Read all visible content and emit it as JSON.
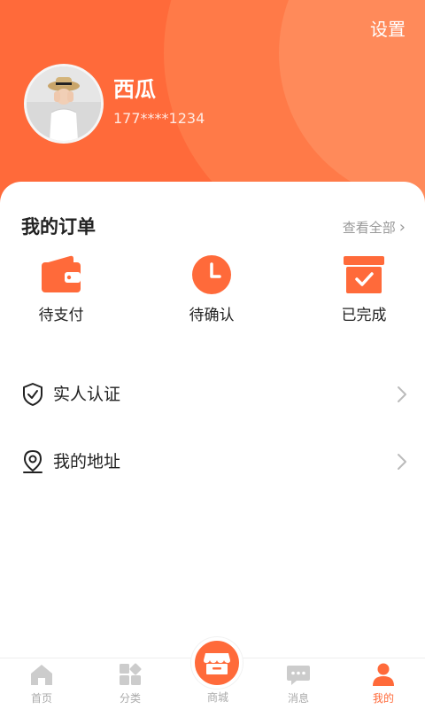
{
  "colors": {
    "accent": "#ff6a3a",
    "text": "#222222",
    "muted": "#999999",
    "tab_inactive": "#aaaaaa"
  },
  "header": {
    "settings_label": "设置",
    "username": "西瓜",
    "phone": "177****1234"
  },
  "orders": {
    "title": "我的订单",
    "view_all_label": "查看全部",
    "items": [
      {
        "label": "待支付",
        "icon": "wallet-icon"
      },
      {
        "label": "待确认",
        "icon": "clock-icon"
      },
      {
        "label": "已完成",
        "icon": "box-check-icon"
      }
    ]
  },
  "menu": [
    {
      "label": "实人认证",
      "icon": "shield-check-icon"
    },
    {
      "label": "我的地址",
      "icon": "location-pin-icon"
    }
  ],
  "tabbar": {
    "active_index": 4,
    "tabs": [
      {
        "label": "首页",
        "icon": "home-icon"
      },
      {
        "label": "分类",
        "icon": "category-grid-icon"
      },
      {
        "label": "商城",
        "icon": "store-icon"
      },
      {
        "label": "消息",
        "icon": "message-icon"
      },
      {
        "label": "我的",
        "icon": "user-icon"
      }
    ]
  }
}
